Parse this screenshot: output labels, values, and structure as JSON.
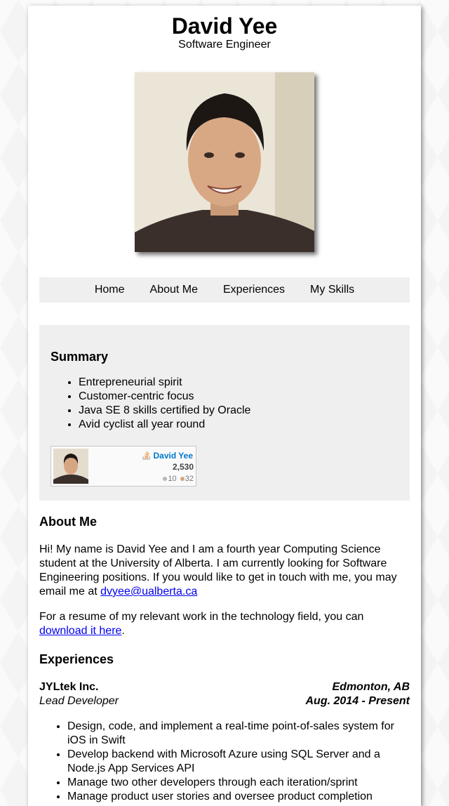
{
  "header": {
    "name": "David Yee",
    "title": "Software Engineer"
  },
  "nav": [
    "Home",
    "About Me",
    "Experiences",
    "My Skills"
  ],
  "summary": {
    "heading": "Summary",
    "items": [
      "Entrepreneurial spirit",
      "Customer-centric focus",
      "Java SE 8 skills certified by Oracle",
      "Avid cyclist all year round"
    ],
    "stackoverflow": {
      "name": "David Yee",
      "reputation": "2,530",
      "silver": "10",
      "bronze": "32"
    }
  },
  "about": {
    "heading": "About Me",
    "p1_text": "Hi! My name is David Yee and I am a fourth year Computing Science student at the University of Alberta. I am currently looking for Software Engineering positions. If you would like to get in touch with me, you may email me at ",
    "email": "dvyee@ualberta.ca",
    "p2_text": "For a resume of my relevant work in the technology field, you can ",
    "download_link": "download it here",
    "p2_end": "."
  },
  "experiences": {
    "heading": "Experiences",
    "jobs": [
      {
        "company": "JYLtek Inc.",
        "location": "Edmonton, AB",
        "role": "Lead Developer",
        "dates": "Aug. 2014 - Present",
        "bullets": [
          "Design, code, and implement a real-time point-of-sales system for iOS in Swift",
          "Develop backend with Microsoft Azure using SQL Server and a Node.js App Services API",
          "Manage two other developers through each iteration/sprint",
          "Manage product user stories and oversee product completion"
        ]
      }
    ]
  },
  "colors": {
    "nav_bg": "#efefef",
    "link": "#0000ee",
    "so_blue": "#0077cc"
  }
}
